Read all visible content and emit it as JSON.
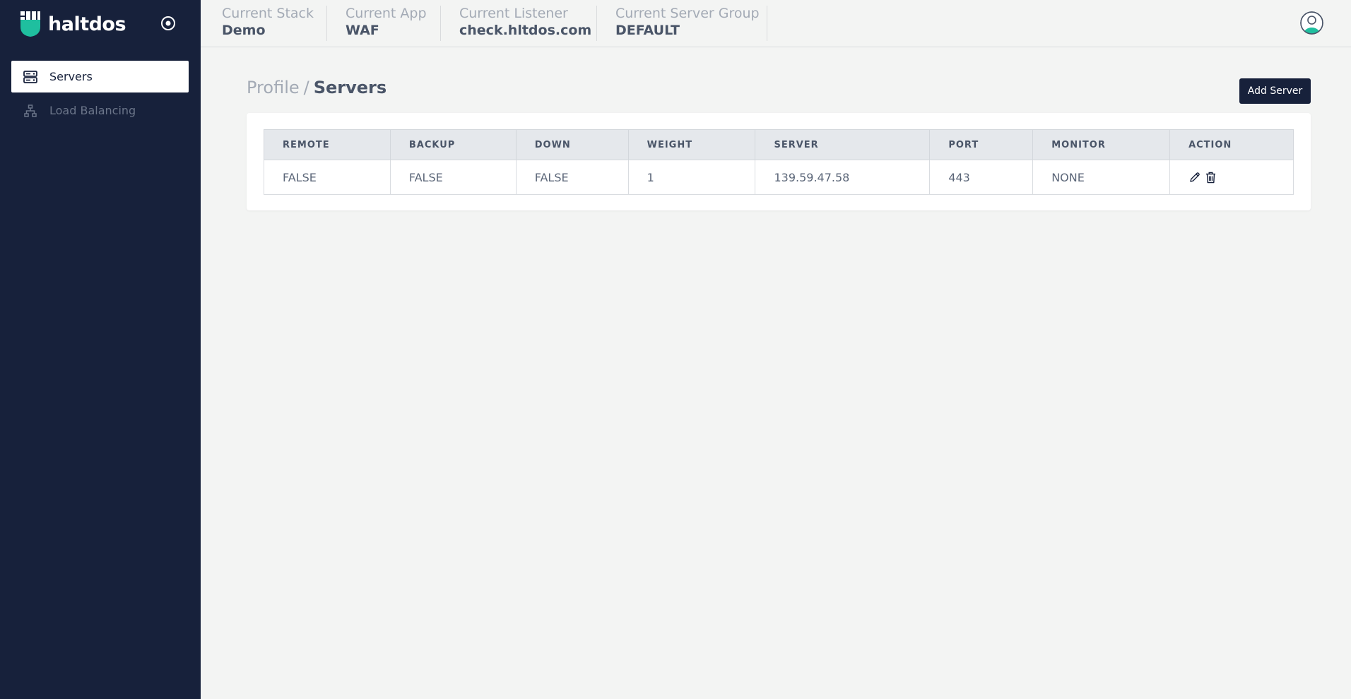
{
  "app": {
    "brand": "haltdos",
    "colors": {
      "sidebar_bg": "#17213b",
      "accent": "#1fbf9f",
      "button_bg": "#17213b"
    }
  },
  "sidebar": {
    "items": [
      {
        "label": "Servers",
        "icon": "server-icon",
        "active": true
      },
      {
        "label": "Load Balancing",
        "icon": "sitemap-icon",
        "active": false
      }
    ]
  },
  "header": {
    "contexts": [
      {
        "label": "Current Stack",
        "value": "Demo"
      },
      {
        "label": "Current App",
        "value": "WAF"
      },
      {
        "label": "Current Listener",
        "value": "check.hltdos.com"
      },
      {
        "label": "Current Server Group",
        "value": "DEFAULT"
      }
    ]
  },
  "breadcrumb": {
    "parent": "Profile",
    "separator": "/",
    "current": "Servers"
  },
  "toolbar": {
    "add_label": "Add Server"
  },
  "table": {
    "columns": [
      "REMOTE",
      "BACKUP",
      "DOWN",
      "WEIGHT",
      "SERVER",
      "PORT",
      "MONITOR",
      "ACTION"
    ],
    "rows": [
      {
        "remote": "FALSE",
        "backup": "FALSE",
        "down": "FALSE",
        "weight": "1",
        "server": "139.59.47.58",
        "port": "443",
        "monitor": "NONE"
      }
    ]
  }
}
